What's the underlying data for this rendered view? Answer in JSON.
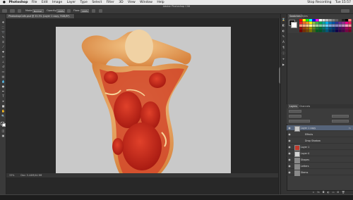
{
  "menubar": {
    "apple": "",
    "app_name": "Photoshop",
    "items": [
      "File",
      "Edit",
      "Image",
      "Layer",
      "Type",
      "Select",
      "Filter",
      "3D",
      "View",
      "Window",
      "Help"
    ],
    "status_right": [
      "Stop Recording",
      "Tue 15:57"
    ]
  },
  "window": {
    "title": "Adobe Photoshop CS6"
  },
  "options": {
    "mode_label": "Mode:",
    "mode_value": "Normal",
    "opacity_label": "Opacity:",
    "opacity_value": "100%",
    "flow_label": "Flow:",
    "flow_value": "100%"
  },
  "document": {
    "tab_title": "PhotoshopCafe.psd @ 33.3% (Layer 1 copy, RGB/8*)",
    "zoom": "33%",
    "doc_size": "Doc: 5.44M/44.9M"
  },
  "panels": {
    "swatches_tab": "Swatches",
    "styles_tab": "Styles",
    "layers_tab": "Layers",
    "channels_tab": "Channels",
    "swatch_colors": [
      "#ff0000",
      "#ffff00",
      "#00ff00",
      "#00ffff",
      "#0000ff",
      "#ff00ff",
      "#ffffff",
      "#e0e0e0",
      "#c0c0c0",
      "#a0a0a0",
      "#808080",
      "#606060",
      "#404040",
      "#202020",
      "#000000",
      "#ff8080",
      "#ed1c24",
      "#f26522",
      "#f7941d",
      "#fff200",
      "#8dc63f",
      "#39b54a",
      "#00a651",
      "#00a99d",
      "#00aeef",
      "#0072bc",
      "#0054a6",
      "#2e3192",
      "#662d91",
      "#92278f",
      "#ec008c",
      "#ed145b",
      "#f69679",
      "#f9ad81",
      "#fdc68a",
      "#fff79a",
      "#c4df9b",
      "#a3d39c",
      "#82ca9d",
      "#7accc8",
      "#6dcff6",
      "#7da7d9",
      "#8393ca",
      "#8781bd",
      "#a187be",
      "#bd8cbf",
      "#f49ac1",
      "#f5989d",
      "#9e0b0f",
      "#a0410d",
      "#a36209",
      "#aba000",
      "#598527",
      "#1a7b30",
      "#007236",
      "#00746b",
      "#0076a3",
      "#004b80",
      "#003471",
      "#1b1464",
      "#440e62",
      "#630460",
      "#9e005d",
      "#9e0039",
      "#790000",
      "#7b2e00",
      "#7d4900",
      "#827b00",
      "#406618",
      "#005e20",
      "#005826",
      "#005952",
      "#005b7f",
      "#003663",
      "#002157",
      "#0d004c",
      "#32004b",
      "#4b0049",
      "#7b0046",
      "#7a0026"
    ],
    "layers": [
      {
        "name": "Layer 1 copy",
        "fx": "fx",
        "selected": true,
        "thumb": "#c8c8c8"
      },
      {
        "name": "Effects",
        "fx": "",
        "selected": false,
        "thumb": ""
      },
      {
        "name": "Drop Shadow",
        "fx": "",
        "selected": false,
        "thumb": ""
      },
      {
        "name": "Layer 1",
        "fx": "",
        "selected": false,
        "thumb": "#c0392b"
      },
      {
        "name": "Layer 0",
        "fx": "",
        "selected": false,
        "thumb": "#d5d5d5"
      },
      {
        "name": "Shapes",
        "fx": "",
        "selected": false,
        "thumb": "#8a8a8a"
      },
      {
        "name": "Letters",
        "fx": "",
        "selected": false,
        "thumb": "#8a8a8a"
      },
      {
        "name": "Stems",
        "fx": "",
        "selected": false,
        "thumb": "#8a8a8a"
      }
    ]
  }
}
